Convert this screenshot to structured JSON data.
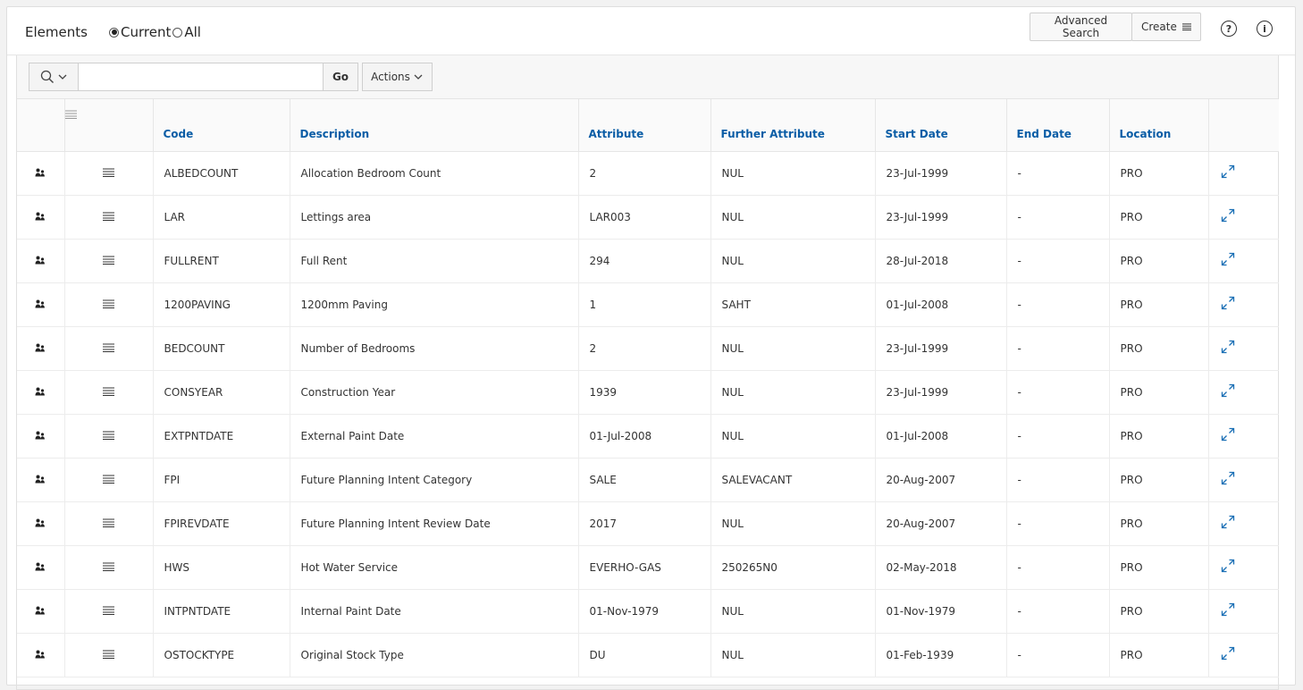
{
  "header": {
    "title": "Elements",
    "radio_current": "Current",
    "radio_all": "All",
    "advanced_search_label": "Advanced Search",
    "create_label": "Create",
    "help_label": "?",
    "info_label": "i"
  },
  "toolbar": {
    "search_placeholder": "",
    "go_label": "Go",
    "actions_label": "Actions"
  },
  "columns": [
    "Code",
    "Description",
    "Attribute",
    "Further Attribute",
    "Start Date",
    "End Date",
    "Location"
  ],
  "rows": [
    {
      "code": "ALBEDCOUNT",
      "description": "Allocation Bedroom Count",
      "attribute": "2",
      "further": "NUL",
      "start": "23-Jul-1999",
      "end": "-",
      "location": "PRO"
    },
    {
      "code": "LAR",
      "description": "Lettings area",
      "attribute": "LAR003",
      "further": "NUL",
      "start": "23-Jul-1999",
      "end": "-",
      "location": "PRO"
    },
    {
      "code": "FULLRENT",
      "description": "Full Rent",
      "attribute": "294",
      "further": "NUL",
      "start": "28-Jul-2018",
      "end": "-",
      "location": "PRO"
    },
    {
      "code": "1200PAVING",
      "description": "1200mm Paving",
      "attribute": "1",
      "further": "SAHT",
      "start": "01-Jul-2008",
      "end": "-",
      "location": "PRO"
    },
    {
      "code": "BEDCOUNT",
      "description": "Number of Bedrooms",
      "attribute": "2",
      "further": "NUL",
      "start": "23-Jul-1999",
      "end": "-",
      "location": "PRO"
    },
    {
      "code": "CONSYEAR",
      "description": "Construction Year",
      "attribute": "1939",
      "further": "NUL",
      "start": "23-Jul-1999",
      "end": "-",
      "location": "PRO"
    },
    {
      "code": "EXTPNTDATE",
      "description": "External Paint Date",
      "attribute": "01-Jul-2008",
      "further": "NUL",
      "start": "01-Jul-2008",
      "end": "-",
      "location": "PRO"
    },
    {
      "code": "FPI",
      "description": "Future Planning Intent Category",
      "attribute": "SALE",
      "further": "SALEVACANT",
      "start": "20-Aug-2007",
      "end": "-",
      "location": "PRO"
    },
    {
      "code": "FPIREVDATE",
      "description": "Future Planning Intent Review Date",
      "attribute": "2017",
      "further": "NUL",
      "start": "20-Aug-2007",
      "end": "-",
      "location": "PRO"
    },
    {
      "code": "HWS",
      "description": "Hot Water Service",
      "attribute": "EVERHO-GAS",
      "further": "250265N0",
      "start": "02-May-2018",
      "end": "-",
      "location": "PRO"
    },
    {
      "code": "INTPNTDATE",
      "description": "Internal Paint Date",
      "attribute": "01-Nov-1979",
      "further": "NUL",
      "start": "01-Nov-1979",
      "end": "-",
      "location": "PRO"
    },
    {
      "code": "OSTOCKTYPE",
      "description": "Original Stock Type",
      "attribute": "DU",
      "further": "NUL",
      "start": "01-Feb-1939",
      "end": "-",
      "location": "PRO"
    }
  ],
  "colors": {
    "link": "#0a5da6",
    "expand_icon": "#1a6fb5"
  }
}
